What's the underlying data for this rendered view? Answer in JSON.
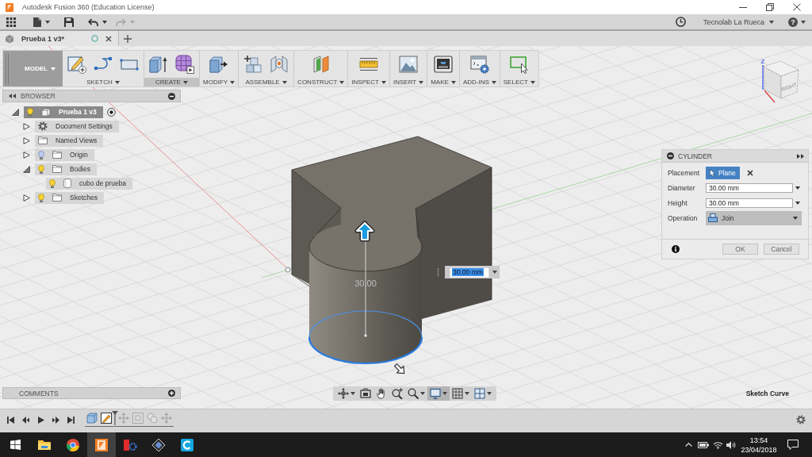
{
  "window": {
    "title": "Autodesk Fusion 360 (Education License)"
  },
  "quick_access": {
    "undo_disabled": false,
    "redo_disabled": true,
    "user": "Tecnolab La Rueca",
    "help": "?"
  },
  "document_tabs": [
    {
      "label": "Prueba 1 v3*",
      "selected": true
    }
  ],
  "toolbar": {
    "workspace": "MODEL",
    "groups": [
      {
        "label": "SKETCH",
        "active": false
      },
      {
        "label": "CREATE",
        "active": true
      },
      {
        "label": "MODIFY",
        "active": false
      },
      {
        "label": "ASSEMBLE",
        "active": false
      },
      {
        "label": "CONSTRUCT",
        "active": false
      },
      {
        "label": "INSPECT",
        "active": false
      },
      {
        "label": "INSERT",
        "active": false
      },
      {
        "label": "MAKE",
        "active": false
      },
      {
        "label": "ADD-INS",
        "active": false
      },
      {
        "label": "SELECT",
        "active": false
      }
    ]
  },
  "browser": {
    "title": "BROWSER",
    "tree": [
      {
        "label": "Prueba 1 v3",
        "kind": "component",
        "selected": true,
        "visible": true,
        "expanded": true,
        "children": [
          {
            "label": "Document Settings",
            "kind": "settings",
            "selected": false,
            "expanded": false
          },
          {
            "label": "Named Views",
            "kind": "folder",
            "selected": false,
            "expanded": false
          },
          {
            "label": "Origin",
            "kind": "folder",
            "selected": false,
            "visible": false,
            "expanded": false
          },
          {
            "label": "Bodies",
            "kind": "folder",
            "selected": false,
            "visible": true,
            "expanded": true,
            "children": [
              {
                "label": "cubo de prueba",
                "kind": "body",
                "selected": false,
                "visible": true
              }
            ]
          },
          {
            "label": "Sketches",
            "kind": "folder",
            "selected": false,
            "visible": true,
            "expanded": false
          }
        ]
      }
    ]
  },
  "view_cube": {
    "face": "RIGHT",
    "axis": "Z"
  },
  "viewport": {
    "dimension_label": "30.00",
    "dimension_input": "30.00 mm",
    "status": "Sketch Curve"
  },
  "cylinder_dialog": {
    "title": "CYLINDER",
    "fields": [
      {
        "label": "Placement",
        "kind": "selection",
        "value": "Plane",
        "selected": true
      },
      {
        "label": "Diameter",
        "kind": "input",
        "value": "30.00 mm"
      },
      {
        "label": "Height",
        "kind": "input",
        "value": "30.00 mm"
      },
      {
        "label": "Operation",
        "kind": "dropdown",
        "value": "Join"
      }
    ],
    "buttons": [
      "OK",
      "Cancel"
    ]
  },
  "comments": {
    "title": "COMMENTS"
  },
  "navigation_bar": [
    {
      "active": false
    },
    {
      "active": false
    },
    {
      "active": false
    },
    {
      "active": false
    },
    {
      "active": false
    },
    {
      "active": true
    },
    {
      "active": false
    },
    {
      "active": false
    }
  ],
  "timeline": {
    "features": [
      {
        "kind": "body",
        "rolled_back": false
      },
      {
        "kind": "sketch",
        "rolled_back": false
      },
      {
        "kind": "move",
        "rolled_back": true
      },
      {
        "kind": "component",
        "rolled_back": true
      },
      {
        "kind": "joint",
        "rolled_back": true
      },
      {
        "kind": "move",
        "rolled_back": true
      }
    ]
  },
  "taskbar": {
    "apps": [
      {
        "active": false
      },
      {
        "active": false
      },
      {
        "active": true
      },
      {
        "active": false
      },
      {
        "active": false
      },
      {
        "active": false
      }
    ],
    "time": "13:54",
    "date": "23/04/2018"
  }
}
